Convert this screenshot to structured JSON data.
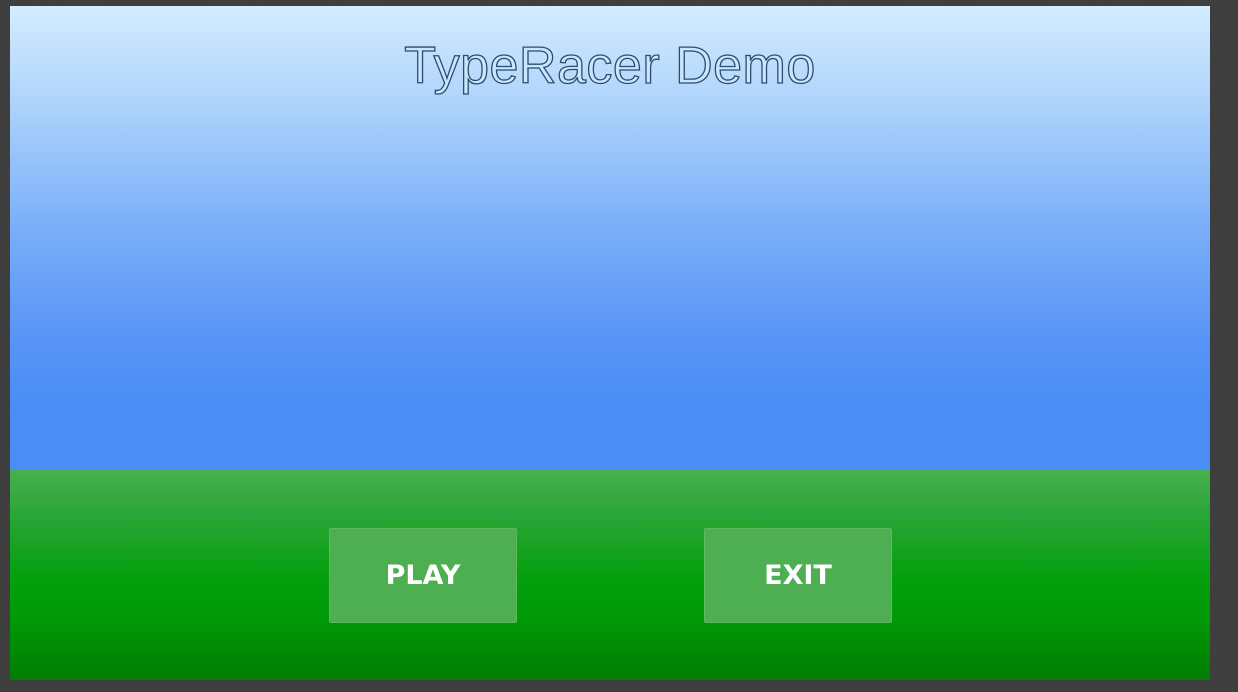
{
  "game": {
    "title": "TypeRacer Demo"
  },
  "menu": {
    "play_label": "PLAY",
    "exit_label": "EXIT"
  },
  "colors": {
    "sky_top": "#d4ecfe",
    "sky_bottom": "#4a8df5",
    "ground_top": "#48b04c",
    "ground_bottom": "#007d03",
    "button_bg": "#4daf52",
    "title_fill": "#c9e5ff",
    "title_outline": "#2a4e6c"
  }
}
